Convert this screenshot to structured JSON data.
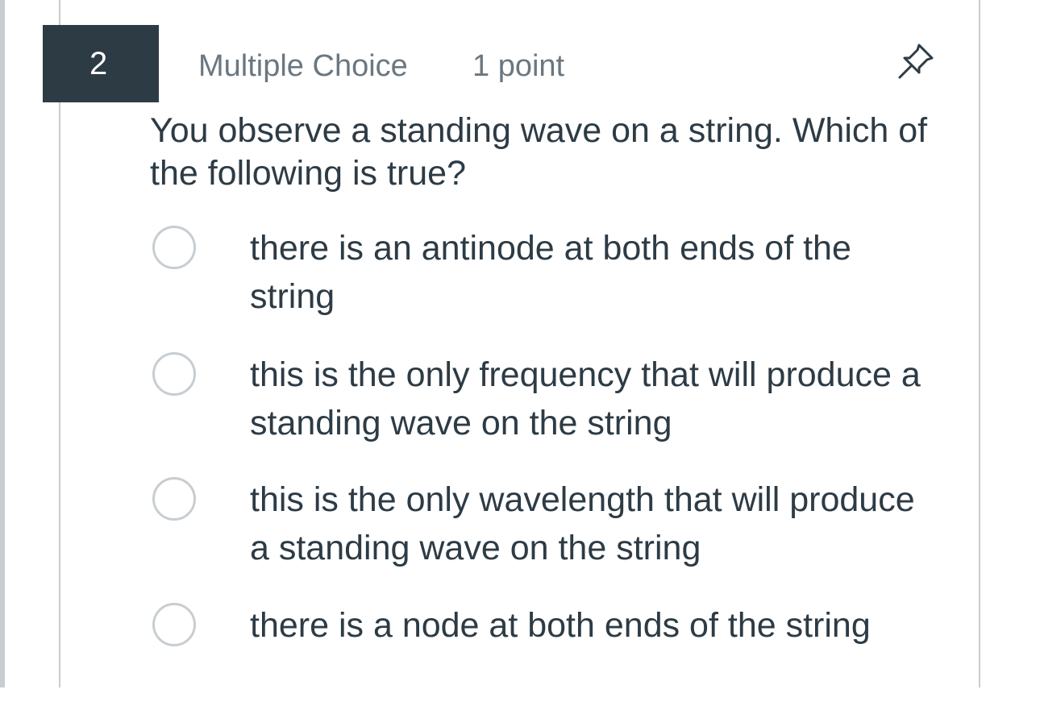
{
  "question": {
    "number": "2",
    "type": "Multiple Choice",
    "points": "1 point",
    "text": "You observe a standing wave on a string. Which of the following is true?",
    "pin_icon": "pin-icon",
    "options": [
      {
        "label": "there is an antinode at both ends of the string",
        "selected": false
      },
      {
        "label": "this is the only frequency that will produce a standing wave on the string",
        "selected": false
      },
      {
        "label": "this is the only wavelength that will produce a standing wave on the string",
        "selected": false
      },
      {
        "label": "there is a node at both ends of the string",
        "selected": false
      }
    ]
  },
  "colors": {
    "header_badge": "#2d3b45",
    "text": "#2d3b45",
    "muted_text": "#6b7780",
    "border": "#c7cdd1"
  }
}
